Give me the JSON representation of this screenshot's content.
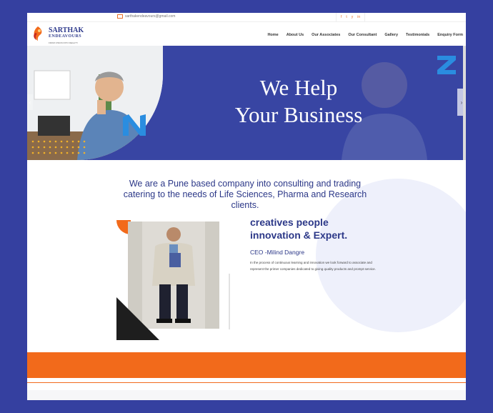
{
  "topbar": {
    "email": "sarthakendeavours@gmail.com",
    "social": [
      "f",
      "t",
      "y",
      "in"
    ]
  },
  "header": {
    "logo_line1": "SARTHAK",
    "logo_line2": "ENDEAVOURS",
    "logo_line3": "FROM VISION INTO REALITY",
    "nav": [
      "Home",
      "About Us",
      "Our Associates",
      "Our Consultant",
      "Gallery",
      "Testimonials",
      "Enquiry Form"
    ]
  },
  "hero": {
    "headline_line1": "We Help",
    "headline_line2": "Your Business",
    "prev_arrow": "‹",
    "next_arrow": "›"
  },
  "intro": {
    "text": "We are a Pune based company into consulting and trading catering to the needs of Life Sciences, Pharma and Research clients."
  },
  "about": {
    "tagline_line1": "creatives people",
    "tagline_line2": "innovation & Expert.",
    "ceo": "CEO -Milind Dangre",
    "description": "In the process of continuous learning and innovation we look forward to associate and represent the primer companies dedicated to giving quality products and prompt service."
  },
  "colors": {
    "brand_blue": "#2c3888",
    "accent_orange": "#f26a1b",
    "background": "#3540a0"
  }
}
